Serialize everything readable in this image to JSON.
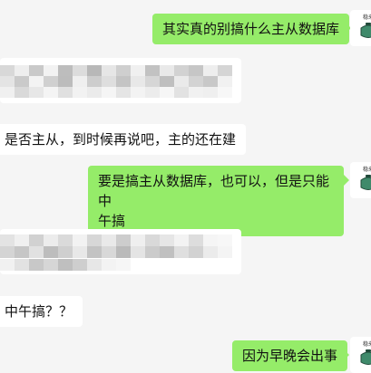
{
  "chat": {
    "messages": [
      {
        "id": "m1",
        "side": "out",
        "text": "其实真的别搞什么主从数据库"
      },
      {
        "id": "m2",
        "side": "in",
        "text": "",
        "redacted": true
      },
      {
        "id": "m3",
        "side": "in",
        "text": "是否主从，到时候再说吧，主的还在建"
      },
      {
        "id": "m4",
        "side": "out",
        "text": "要是搞主从数据库，也可以，但是只能中\n午搞"
      },
      {
        "id": "m5",
        "side": "in",
        "text": "",
        "redacted": true
      },
      {
        "id": "m6",
        "side": "in",
        "text": "中午搞？？"
      },
      {
        "id": "m7",
        "side": "out",
        "text": "因为早晚会出事"
      }
    ]
  },
  "avatar": {
    "tag_text": "稳来",
    "icon": "tea-pot-icon"
  },
  "colors": {
    "outgoing_bubble": "#95ec69",
    "incoming_bubble": "#ffffff",
    "background": "#f5f5f5"
  }
}
